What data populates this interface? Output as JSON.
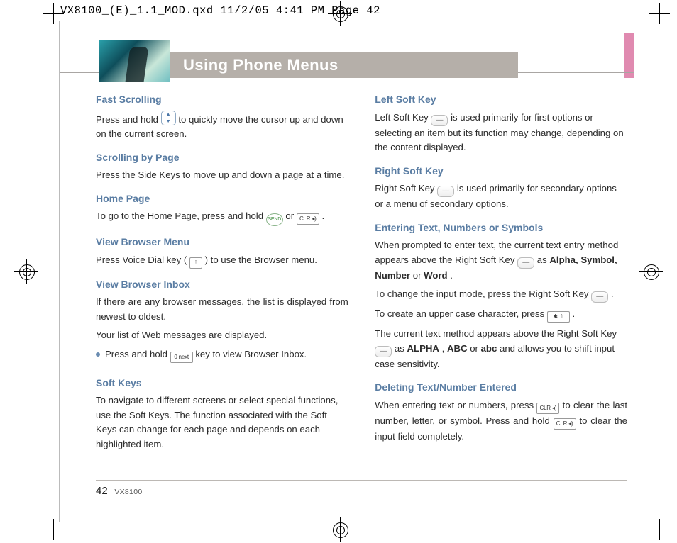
{
  "proof_header": "VX8100_(E)_1.1_MOD.qxd  11/2/05  4:41 PM  Page 42",
  "page_title": "Using Phone Menus",
  "page_number": "42",
  "model": "VX8100",
  "keys": {
    "send": "SEND",
    "clr": "CLR ◂)",
    "clr2": "CLR ◂)",
    "zero": "0 next",
    "voice": "⁞",
    "star": "✱ ⇧"
  },
  "left": {
    "h1": "Fast Scrolling",
    "p1a": "Press and hold ",
    "p1b": " to quickly move the cursor up and down on the current screen.",
    "h2": "Scrolling by Page",
    "p2": "Press the Side Keys to move up and down a page at a time.",
    "h3": "Home Page",
    "p3a": "To go to the Home Page, press and hold ",
    "p3_or": " or ",
    "p3b": ".",
    "h4": "View Browser Menu",
    "p4a": "Press Voice Dial key ( ",
    "p4b": " ) to use the Browser menu.",
    "h5": "View Browser Inbox",
    "p5": "If there are any browser messages, the list is displayed from newest to oldest.",
    "p5b": "Your list of Web messages are displayed.",
    "p5c_a": "Press and hold ",
    "p5c_b": " key to view Browser Inbox.",
    "h6": "Soft Keys",
    "p6": "To navigate to different screens or select special functions, use the Soft Keys. The function associated with the Soft Keys can change for each page and depends on each highlighted item."
  },
  "right": {
    "h1": "Left Soft Key",
    "p1a": "Left Soft Key ",
    "p1b": " is used primarily for first options or selecting an item but its function may change, depending on the content displayed.",
    "h2": "Right Soft Key",
    "p2a": "Right Soft Key ",
    "p2b": " is used primarily for secondary options or a menu of secondary options.",
    "h3": "Entering Text, Numbers or Symbols",
    "p3a": "When prompted to enter text, the current text entry method appears above the Right Soft Key ",
    "p3b": " as ",
    "p3_bold1": "Alpha, Symbol, Number",
    "p3_or": " or ",
    "p3_bold2": "Word",
    "p3c": ".",
    "p3d": "To change the input mode, press the Right Soft Key ",
    "p3e": ".",
    "p3f": "To create an upper case character, press ",
    "p3g": ".",
    "p3h": "The current text method appears above the Right Soft Key ",
    "p3i": " as ",
    "p3_bold3": "ALPHA",
    "p3_comma": " , ",
    "p3_bold4": "ABC",
    "p3_or2": " or ",
    "p3_bold5": "abc",
    "p3j": " and allows you to shift input case sensitivity.",
    "h4": "Deleting Text/Number Entered",
    "p4a": "When entering text or numbers, press ",
    "p4b": " to clear the last number, letter, or symbol. Press and hold ",
    "p4c": " to clear the input field completely."
  }
}
